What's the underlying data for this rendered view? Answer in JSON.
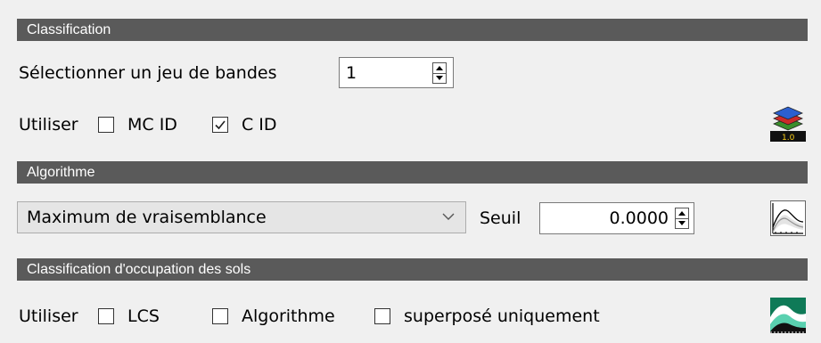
{
  "classification": {
    "header": "Classification",
    "band_set_label": "Sélectionner un jeu de bandes",
    "band_set_value": "1",
    "use_label": "Utiliser",
    "mc_id_label": "MC ID",
    "mc_id_checked": false,
    "c_id_label": "C ID",
    "c_id_checked": true,
    "tool_icon": "classification-preview-icon",
    "tool_icon_text": "1.0"
  },
  "algorithm": {
    "header": "Algorithme",
    "selected": "Maximum de vraisemblance",
    "threshold_label": "Seuil",
    "threshold_value": "0.0000",
    "tool_icon": "spectral-signature-plot-icon"
  },
  "land_cover": {
    "header": "Classification d'occupation des sols",
    "use_label": "Utiliser",
    "lcs_label": "LCS",
    "lcs_checked": false,
    "algorithm_label": "Algorithme",
    "algorithm_checked": false,
    "overlap_label": "superposé uniquement",
    "overlap_checked": false,
    "tool_icon": "land-cover-signature-icon"
  },
  "colors": {
    "header_bg": "#5a5a5a",
    "header_fg": "#ffffff",
    "background": "#f0f0f0"
  }
}
